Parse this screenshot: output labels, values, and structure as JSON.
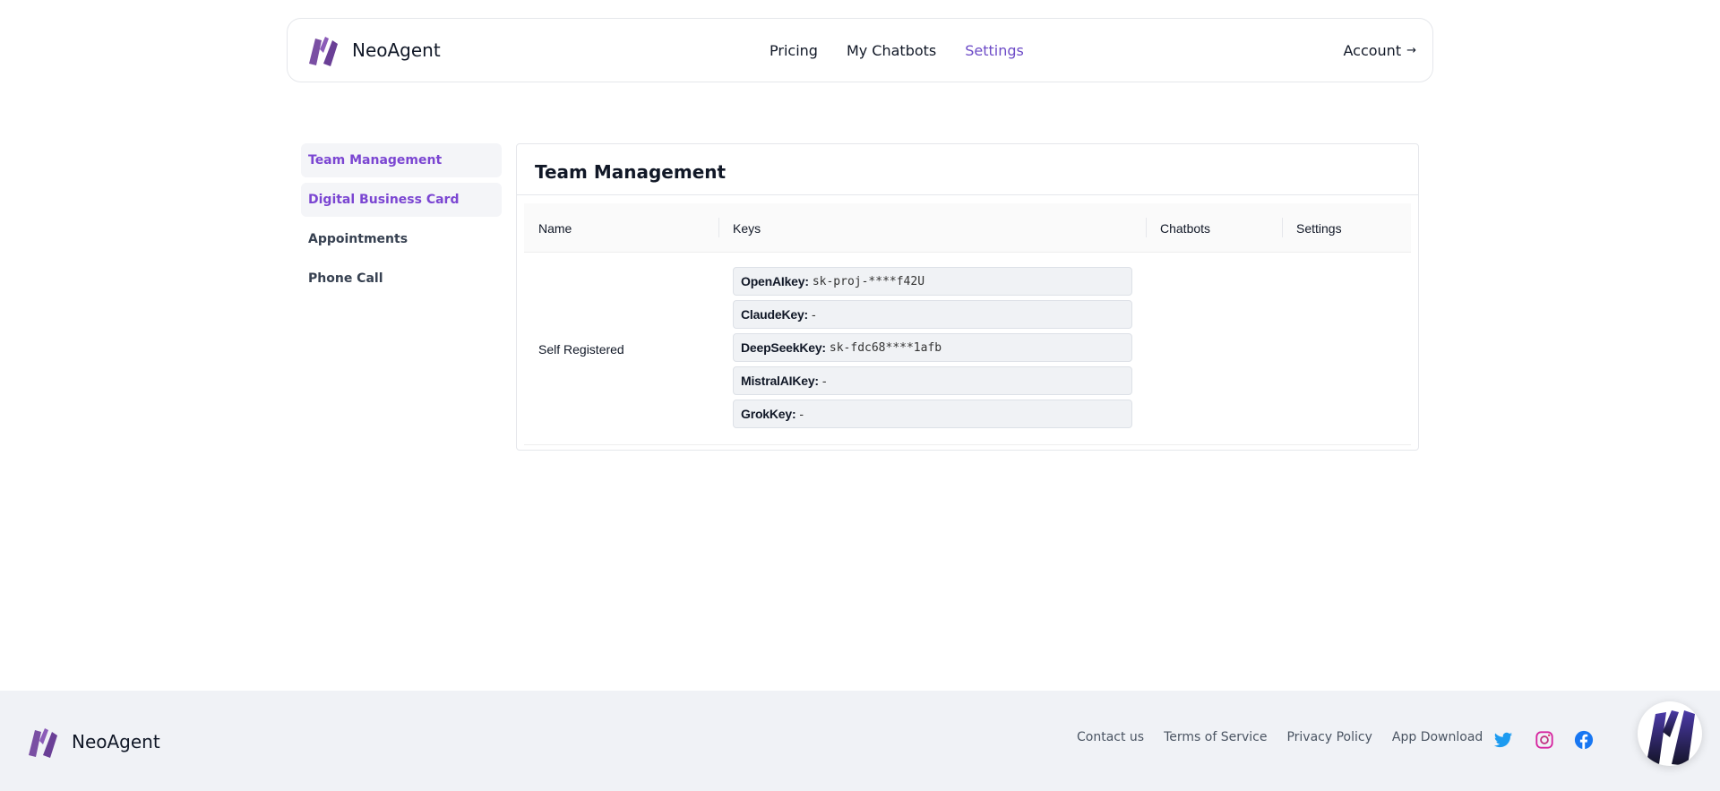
{
  "header": {
    "brand": "NeoAgent",
    "nav": [
      "Pricing",
      "My Chatbots",
      "Settings"
    ],
    "active_nav": "Settings",
    "account_label": "Account",
    "account_arrow": "→"
  },
  "sidebar": {
    "items": [
      "Team Management",
      "Digital Business Card",
      "Appointments",
      "Phone Call"
    ]
  },
  "main": {
    "title": "Team Management",
    "columns": [
      "Name",
      "Keys",
      "Chatbots",
      "Settings"
    ],
    "rows": [
      {
        "name": "Self Registered",
        "keys": [
          {
            "label": "OpenAIkey:",
            "value": "sk-proj-****f42U"
          },
          {
            "label": "ClaudeKey:",
            "value": "-"
          },
          {
            "label": "DeepSeekKey:",
            "value": "sk-fdc68****1afb"
          },
          {
            "label": "MistralAIKey:",
            "value": "-"
          },
          {
            "label": "GrokKey:",
            "value": "-"
          }
        ],
        "chatbots": "",
        "settings": ""
      }
    ]
  },
  "footer": {
    "brand": "NeoAgent",
    "links": [
      "Contact us",
      "Terms of Service",
      "Privacy Policy",
      "App Download"
    ],
    "social_icons": [
      "twitter-icon",
      "instagram-icon",
      "facebook-icon"
    ]
  },
  "colors": {
    "accent": "#6d4bc7",
    "sidebar_highlight_text": "#7b46d2",
    "footer_bg": "#f0f2f6",
    "twitter": "#1d9bf0",
    "facebook": "#1877f2"
  }
}
